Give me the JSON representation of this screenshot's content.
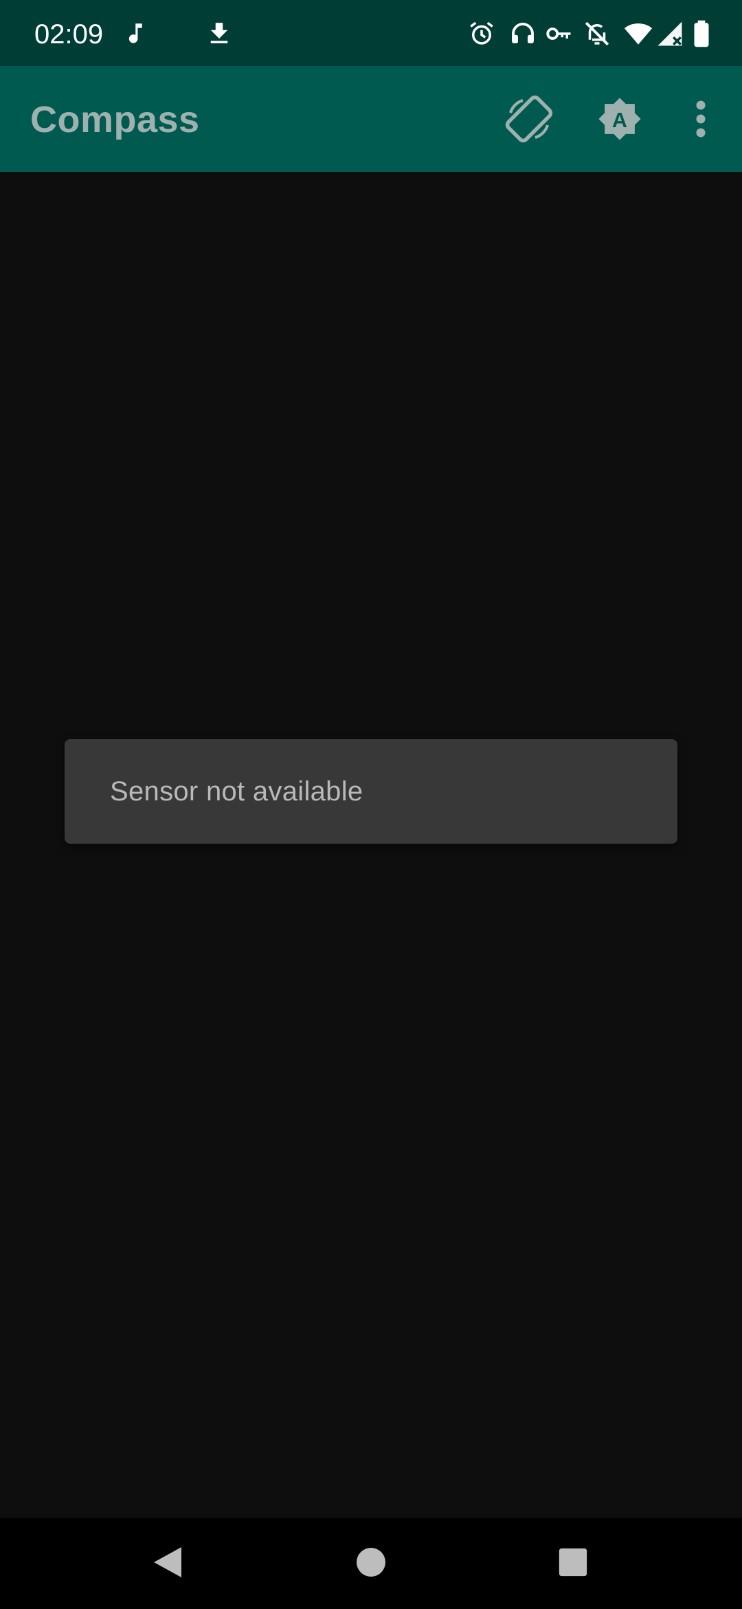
{
  "status_bar": {
    "time": "02:09",
    "icons": [
      "music-note-icon",
      "download-icon",
      "alarm-icon",
      "headset-icon",
      "vpn-key-icon",
      "notifications-off-icon",
      "wifi-icon",
      "cellular-signal-icon",
      "battery-icon"
    ],
    "background": "#003d35"
  },
  "app_bar": {
    "title": "Compass",
    "actions": [
      "screen-rotation-icon",
      "auto-brightness-icon",
      "more-options-icon"
    ],
    "background": "#005a50"
  },
  "toast": {
    "message": "Sensor not available"
  },
  "navigation_bar": {
    "buttons": [
      "back-icon",
      "home-icon",
      "recents-icon"
    ]
  },
  "colors": {
    "content_background": "#0e0e0e",
    "title_text": "#9fb1ae",
    "toast_background": "#383838"
  }
}
